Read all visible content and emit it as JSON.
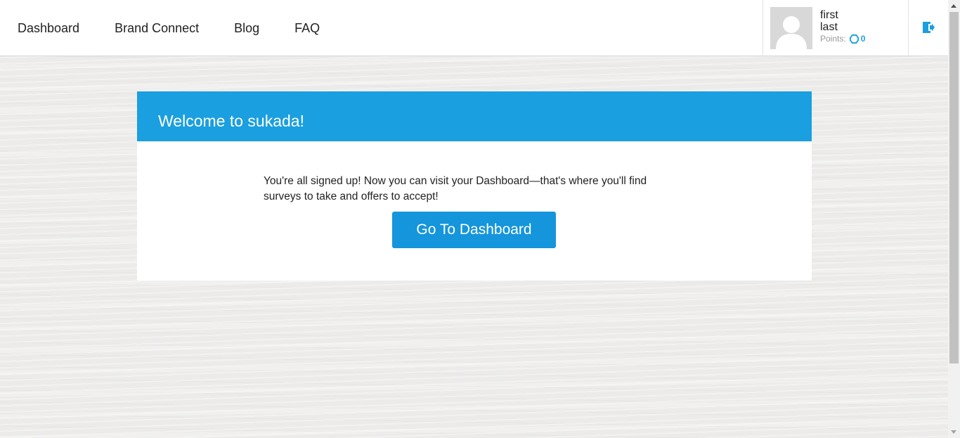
{
  "nav": {
    "items": [
      {
        "label": "Dashboard"
      },
      {
        "label": "Brand Connect"
      },
      {
        "label": "Blog"
      },
      {
        "label": "FAQ"
      }
    ]
  },
  "user": {
    "first_name": "first",
    "last_name": "last",
    "points_label": "Points:",
    "points_value": "0"
  },
  "icons": {
    "avatar": "avatar-placeholder-icon",
    "points": "points-coin-icon",
    "logout": "logout-icon"
  },
  "card": {
    "title": "Welcome to sukada!",
    "message": "You're all signed up! Now you can visit your Dashboard—that's where you'll find surveys to take and offers to accept!",
    "button_label": "Go To Dashboard"
  },
  "colors": {
    "accent": "#1a9fe0",
    "button": "#1495dc",
    "background": "#ecebea"
  }
}
